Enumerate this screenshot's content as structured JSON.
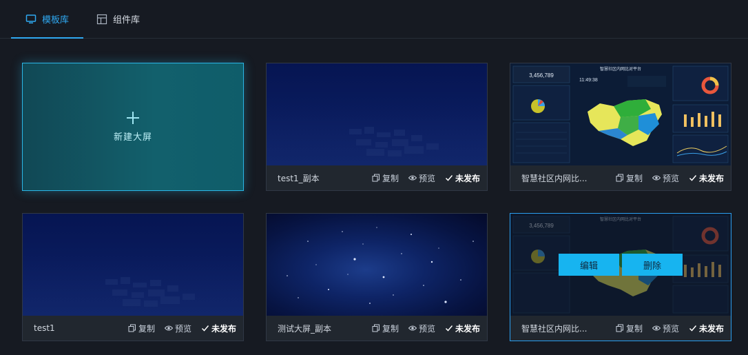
{
  "tabs": [
    {
      "label": "模板库",
      "active": true
    },
    {
      "label": "组件库",
      "active": false
    }
  ],
  "new_screen": {
    "label": "新建大屏"
  },
  "actions": {
    "copy": "复制",
    "preview": "预览",
    "status": "未发布"
  },
  "overlay": {
    "edit": "编辑",
    "delete": "删除"
  },
  "cards": [
    {
      "name": "test1_副本",
      "thumbnail": "city-dark"
    },
    {
      "name": "智慧社区内网比...",
      "thumbnail": "dashboard"
    },
    {
      "name": "test1",
      "thumbnail": "city-dark"
    },
    {
      "name": "测试大屏_副本",
      "thumbnail": "starfield"
    },
    {
      "name": "智慧社区内网比...",
      "thumbnail": "dashboard"
    }
  ],
  "dashboard": {
    "title": "智慧社区内网比对平台",
    "counter": "3,456,789",
    "time": "11:49:38"
  },
  "colors": {
    "accent": "#2fa9f2",
    "overlay_button": "#17b4f0",
    "new_card_border": "#2bb6e6"
  }
}
